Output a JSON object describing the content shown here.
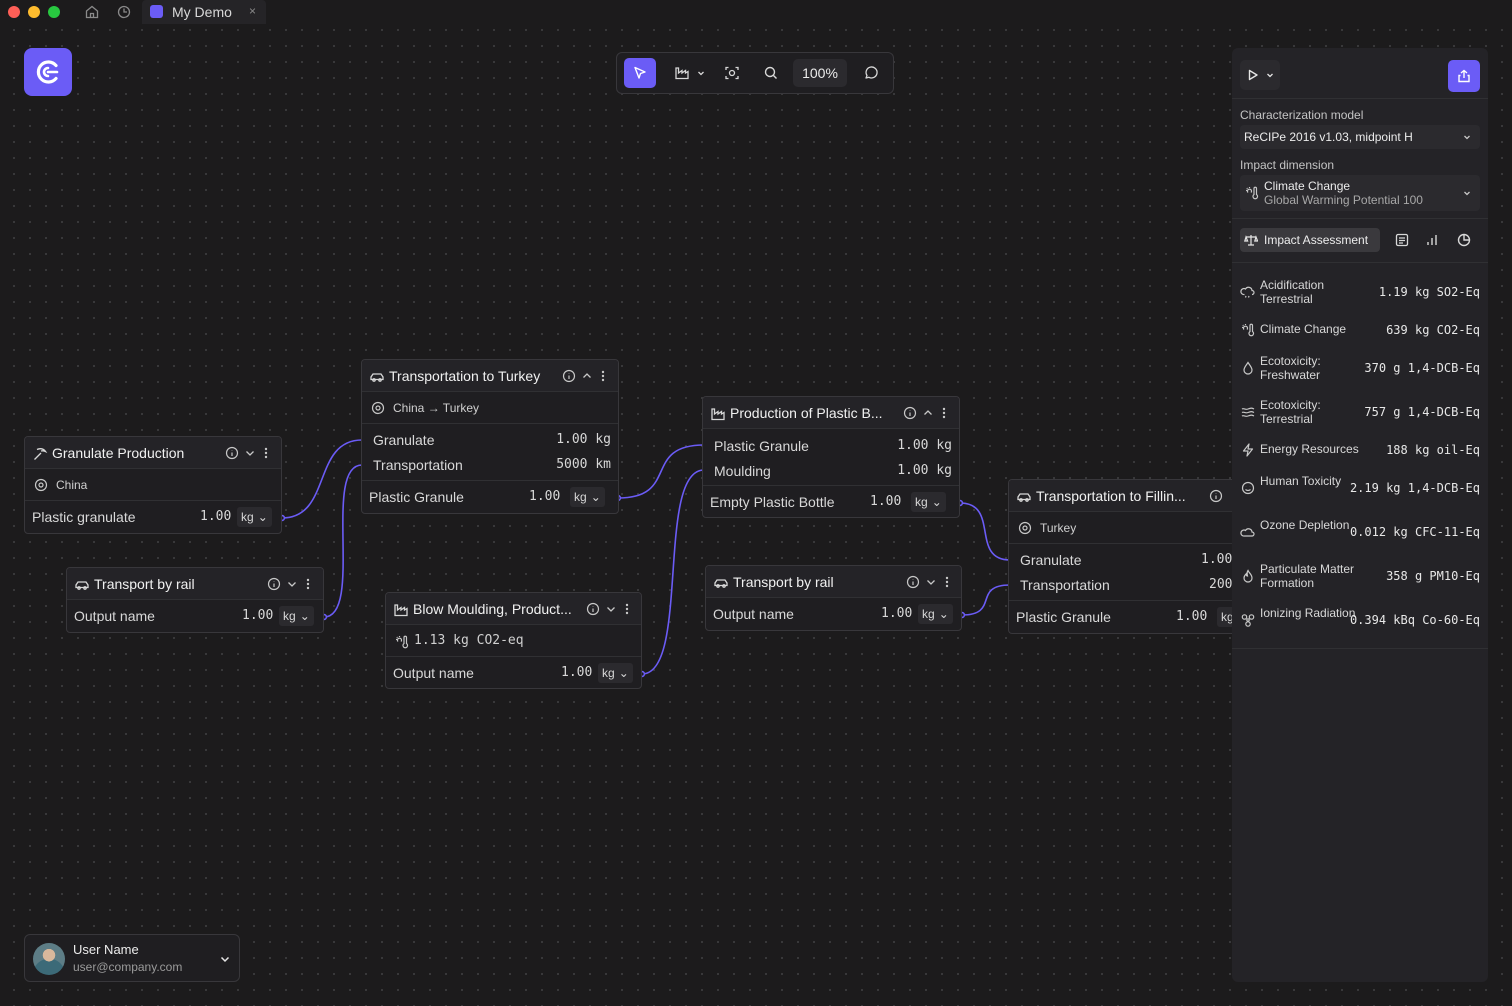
{
  "window": {
    "tab_title": "My Demo",
    "tab_close": "×"
  },
  "toolbar": {
    "zoom": "100%"
  },
  "nodes": {
    "granulate_production": {
      "title": "Granulate Production",
      "location": "China",
      "output_label": "Plastic granulate",
      "output_value": "1.00",
      "output_unit": "kg"
    },
    "transport_rail_1": {
      "title": "Transport by rail",
      "output_label": "Output name",
      "output_value": "1.00",
      "output_unit": "kg"
    },
    "transport_turkey": {
      "title": "Transportation to Turkey",
      "location": "China → Turkey",
      "inputs": [
        {
          "label": "Granulate",
          "value": "1.00 kg"
        },
        {
          "label": "Transportation",
          "value": "5000 km"
        }
      ],
      "output_label": "Plastic Granule",
      "output_value": "1.00",
      "output_unit": "kg"
    },
    "blow_moulding": {
      "title": "Blow Moulding, Product...",
      "impact": "1.13 kg CO2-eq",
      "output_label": "Output name",
      "output_value": "1.00",
      "output_unit": "kg"
    },
    "production_plastic": {
      "title": "Production of Plastic B...",
      "inputs": [
        {
          "label": "Plastic Granule",
          "value": "1.00 kg"
        },
        {
          "label": "Moulding",
          "value": "1.00 kg"
        }
      ],
      "output_label": "Empty Plastic Bottle",
      "output_value": "1.00",
      "output_unit": "kg"
    },
    "transport_rail_2": {
      "title": "Transport by rail",
      "output_label": "Output name",
      "output_value": "1.00",
      "output_unit": "kg"
    },
    "transport_filling": {
      "title": "Transportation to Fillin...",
      "location": "Turkey",
      "inputs": [
        {
          "label": "Granulate",
          "value": "1.00"
        },
        {
          "label": "Transportation",
          "value": "200"
        }
      ],
      "output_label": "Plastic Granule",
      "output_value": "1.00",
      "output_unit": "kg"
    }
  },
  "panel": {
    "characterization_label": "Characterization model",
    "characterization_value": "ReCIPe 2016 v1.03, midpoint H",
    "impact_dimension_label": "Impact dimension",
    "impact_dimension_title": "Climate Change",
    "impact_dimension_subtitle": "Global Warming Potential 100",
    "assessment_button": "Impact Assessment",
    "impacts": [
      {
        "name": "Acidification Terrestrial",
        "value": "1.19 kg SO2-Eq",
        "icon": "cloud-rain-icon"
      },
      {
        "name": "Climate Change",
        "value": "639 kg CO2-Eq",
        "icon": "thermometer-sun-icon"
      },
      {
        "name": "Ecotoxicity: Freshwater",
        "value": "370 g 1,4-DCB-Eq",
        "icon": "droplet-icon"
      },
      {
        "name": "Ecotoxicity: Terrestrial",
        "value": "757 g 1,4-DCB-Eq",
        "icon": "waves-icon"
      },
      {
        "name": "Energy Resources",
        "value": "188 kg oil-Eq",
        "icon": "zap-icon"
      },
      {
        "name": "Human Toxicity",
        "value": "2.19 kg 1,4-DCB-Eq",
        "icon": "face-icon"
      },
      {
        "name": "Ozone Depletion",
        "value": "0.012 kg CFC-11-Eq",
        "icon": "cloud-icon"
      },
      {
        "name": "Particulate Matter Formation",
        "value": "358 g PM10-Eq",
        "icon": "flame-icon"
      },
      {
        "name": "Ionizing Radiation",
        "value": "0.394 kBq Co-60-Eq",
        "icon": "radiation-icon"
      }
    ]
  },
  "user": {
    "name": "User Name",
    "email": "user@company.com"
  },
  "colors": {
    "accent": "#6b5cf6",
    "edge": "#6b5cf6",
    "canvas": "#1c1b1c",
    "node_bg": "#1f1e21",
    "panel_bg": "#242327"
  }
}
